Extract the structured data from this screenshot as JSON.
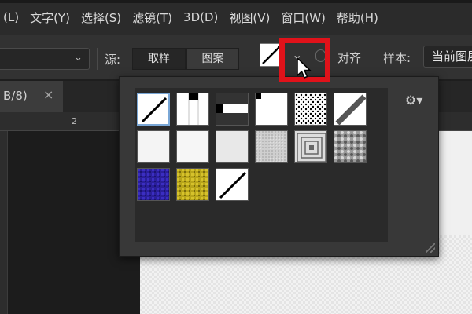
{
  "menu": {
    "items": [
      "(L)",
      "文字(Y)",
      "选择(S)",
      "滤镜(T)",
      "3D(D)",
      "视图(V)",
      "窗口(W)",
      "帮助(H)"
    ]
  },
  "options_bar": {
    "source_label": "源:",
    "sample_button": "取样",
    "pattern_button": "图案",
    "align_label": "对齐",
    "sample_label": "样本:",
    "sample_value": "当前图层"
  },
  "document_tab": {
    "title": "B/8)",
    "close": "×"
  },
  "ruler": {
    "label": "2"
  },
  "pattern_picker": {
    "gear": "⚙▾",
    "patterns": [
      {
        "icon": "diagonal-line-pattern",
        "selected": true
      },
      {
        "icon": "vertical-bar-pattern"
      },
      {
        "icon": "horizontal-bar-pattern"
      },
      {
        "icon": "corner-black-pattern"
      },
      {
        "icon": "dots-pattern"
      },
      {
        "icon": "thick-diagonal-pattern"
      },
      {
        "icon": "light-gray-pattern-1"
      },
      {
        "icon": "light-gray-pattern-2"
      },
      {
        "icon": "light-gray-pattern-3"
      },
      {
        "icon": "noise-gray-pattern"
      },
      {
        "icon": "concentric-squares-pattern"
      },
      {
        "icon": "stone-texture-pattern"
      },
      {
        "icon": "blue-texture-pattern"
      },
      {
        "icon": "yellow-texture-pattern"
      },
      {
        "icon": "diagonal-line-pattern-2"
      }
    ]
  },
  "colors": {
    "highlight": "#e0121a",
    "selection_border": "#7aa7d6"
  }
}
